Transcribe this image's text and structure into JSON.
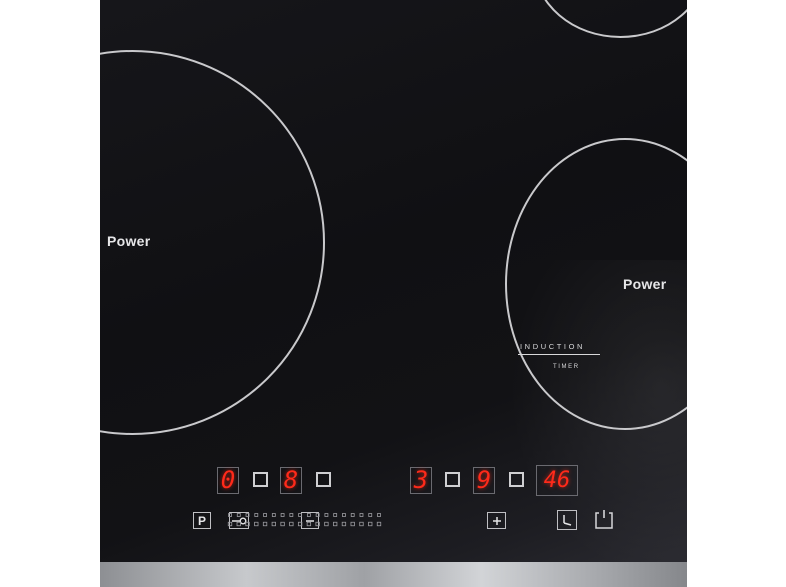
{
  "zones": {
    "large_label": "Power",
    "right_label": "Power",
    "right_brand": "INDUCTION",
    "right_sub": "TIMER"
  },
  "displays": {
    "zone1_level": "0",
    "zone2_level": "8",
    "zone3_level": "3",
    "zone4_level": "9",
    "timer_minutes": "46"
  },
  "controls": {
    "pause_label": "P",
    "slider_minus": "minus",
    "slider_plus": "plus",
    "slider_steps": 18
  },
  "icons": {
    "lock": "key-lock-icon",
    "clock": "clock-icon",
    "power": "power-icon"
  },
  "colors": {
    "glass": "#121215",
    "display_red": "#ff2a1a",
    "marking": "#c9c9cc"
  }
}
